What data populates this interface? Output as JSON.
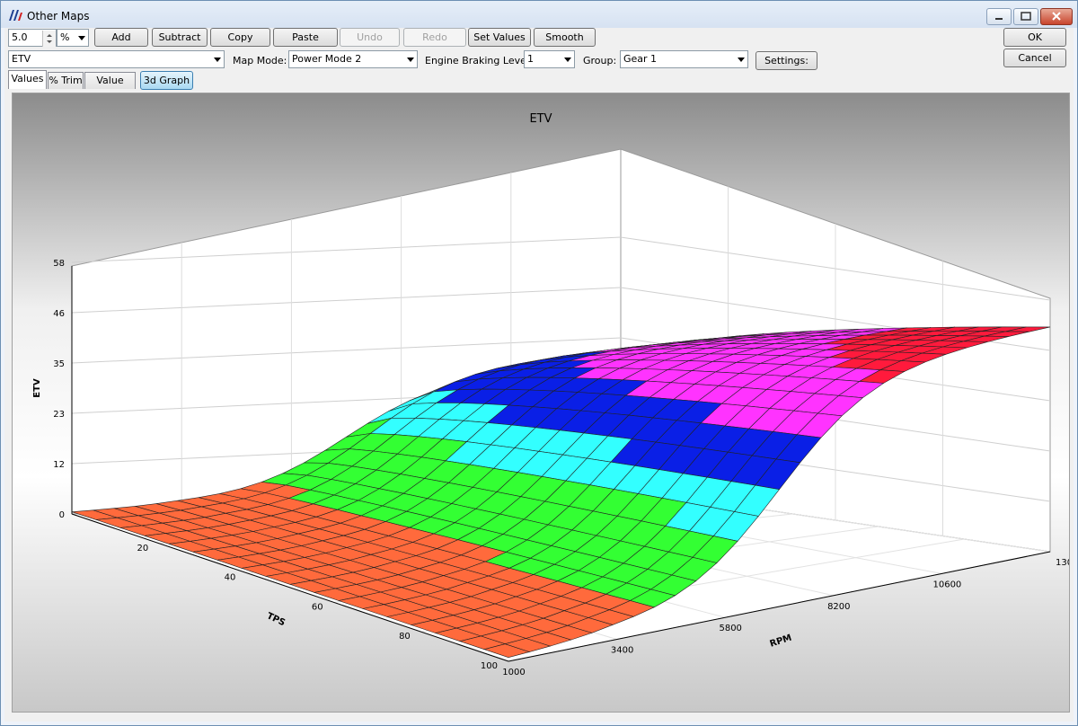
{
  "window": {
    "title": "Other Maps",
    "min_icon": "minimize-icon",
    "max_icon": "maximize-icon",
    "close_icon": "close-icon"
  },
  "toolbar": {
    "step_value": "5.0",
    "unit": "%",
    "buttons": {
      "add": "Add",
      "subtract": "Subtract",
      "copy": "Copy",
      "paste": "Paste",
      "undo": "Undo",
      "redo": "Redo",
      "set_values": "Set Values",
      "smooth": "Smooth"
    },
    "ok": "OK",
    "cancel": "Cancel"
  },
  "selectors": {
    "map": "ETV",
    "map_mode_label": "Map Mode:",
    "map_mode": "Power Mode 2",
    "engine_braking_label": "Engine Braking Level:",
    "engine_braking": "1",
    "group_label": "Group:",
    "group": "Gear 1",
    "settings": "Settings:"
  },
  "tabs": [
    "Values",
    "% Trim",
    "Value Trim"
  ],
  "active_tab": "Values",
  "graph_button": "3d Graph",
  "chart_data": {
    "type": "surface3d",
    "title": "ETV",
    "zlabel": "ETV",
    "xlabel": "RPM",
    "ylabel": "TPS",
    "zticks": [
      "0",
      "12",
      "23",
      "35",
      "46",
      "58"
    ],
    "zlim": [
      0,
      58
    ],
    "rpm_ticks": [
      "1000",
      "3400",
      "5800",
      "8200",
      "10600",
      "130"
    ],
    "tps_ticks": [
      "20",
      "40",
      "60",
      "80",
      "100"
    ],
    "color_bands": [
      "#ff6a3c",
      "#33ff33",
      "#33ffff",
      "#0a1fe6",
      "#ff33ff",
      "#ff1a3c"
    ]
  }
}
